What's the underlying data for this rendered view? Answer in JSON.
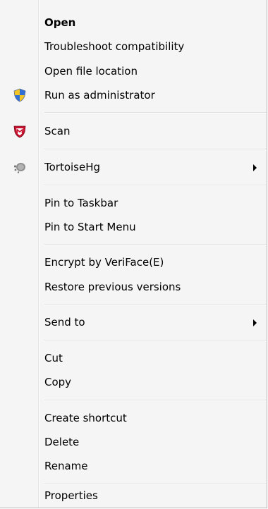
{
  "menu": {
    "items": [
      {
        "label": "Open",
        "bold": true
      },
      {
        "label": "Troubleshoot compatibility"
      },
      {
        "label": "Open file location"
      },
      {
        "label": "Run as administrator",
        "icon": "uac-shield-icon"
      },
      {
        "label": "Scan",
        "icon": "mcafee-shield-icon"
      },
      {
        "label": "TortoiseHg",
        "icon": "tortoisehg-icon",
        "submenu": true
      },
      {
        "label": "Pin to Taskbar"
      },
      {
        "label": "Pin to Start Menu"
      },
      {
        "label": "Encrypt by VeriFace(E)"
      },
      {
        "label": "Restore previous versions"
      },
      {
        "label": "Send to",
        "submenu": true
      },
      {
        "label": "Cut"
      },
      {
        "label": "Copy"
      },
      {
        "label": "Create shortcut"
      },
      {
        "label": "Delete"
      },
      {
        "label": "Rename"
      },
      {
        "label": "Properties"
      }
    ]
  },
  "colors": {
    "background": "#f5f5f5",
    "separator": "#e0e0e0",
    "uac_blue": "#2f6fd6",
    "uac_yellow": "#f3c623",
    "mcafee_red": "#c8102e"
  }
}
